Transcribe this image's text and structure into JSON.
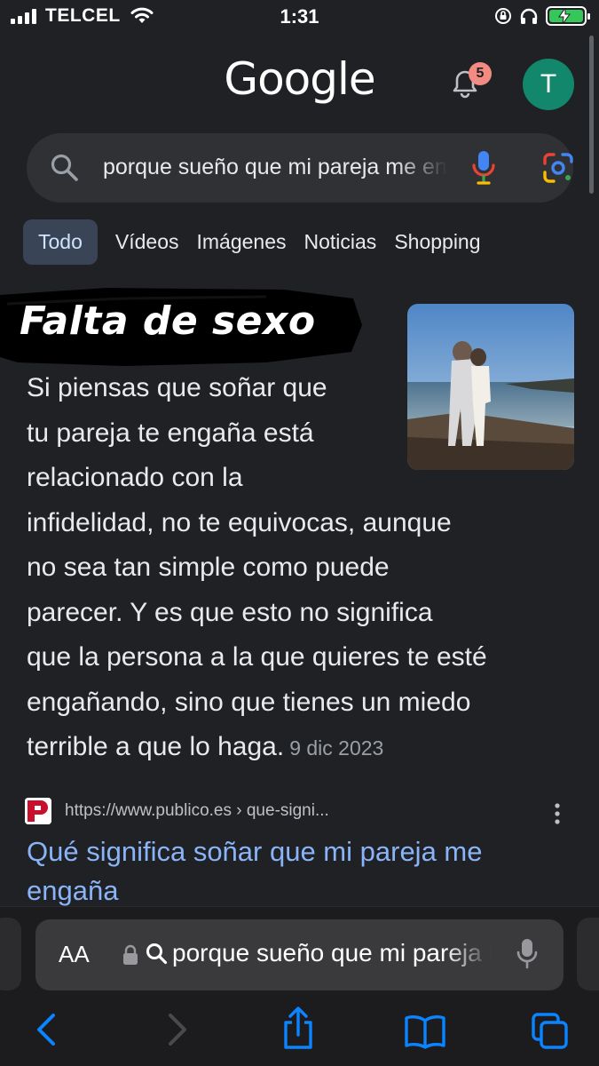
{
  "status_bar": {
    "carrier": "TELCEL",
    "time": "1:31",
    "battery_state": "charging"
  },
  "header": {
    "logo": "Google",
    "notifications_count": "5",
    "avatar_initial": "T"
  },
  "search": {
    "query": "porque sueño que mi pareja me engaña"
  },
  "tabs": [
    {
      "label": "Todo",
      "active": true
    },
    {
      "label": "Vídeos"
    },
    {
      "label": "Imágenes"
    },
    {
      "label": "Noticias"
    },
    {
      "label": "Shopping"
    }
  ],
  "result": {
    "overlay_title": "Falta de sexo",
    "snippet_lines": [
      "Si piensas que soñar que",
      "tu pareja te engaña está",
      "relacionado con la",
      "infidelidad, no te equivocas, aunque",
      "no sea tan simple como puede",
      "parecer. Y es que esto no significa",
      "que la persona a la que quieres te esté",
      "engañando, sino que tienes un miedo",
      "terrible a que lo haga."
    ],
    "date": "9 dic 2023"
  },
  "source": {
    "url": "https://www.publico.es › que-signi...",
    "favicon_letter": "P",
    "title_lines": [
      "Qué significa soñar que mi pareja me",
      "engaña"
    ]
  },
  "safari": {
    "text_size_label": "AA",
    "address_query": "porque sueño que mi pareja me engaña"
  },
  "colors": {
    "background": "#202124",
    "link": "#8ab4f8",
    "active_tab": "#394457",
    "avatar": "#12876b",
    "badge": "#f28b82"
  }
}
